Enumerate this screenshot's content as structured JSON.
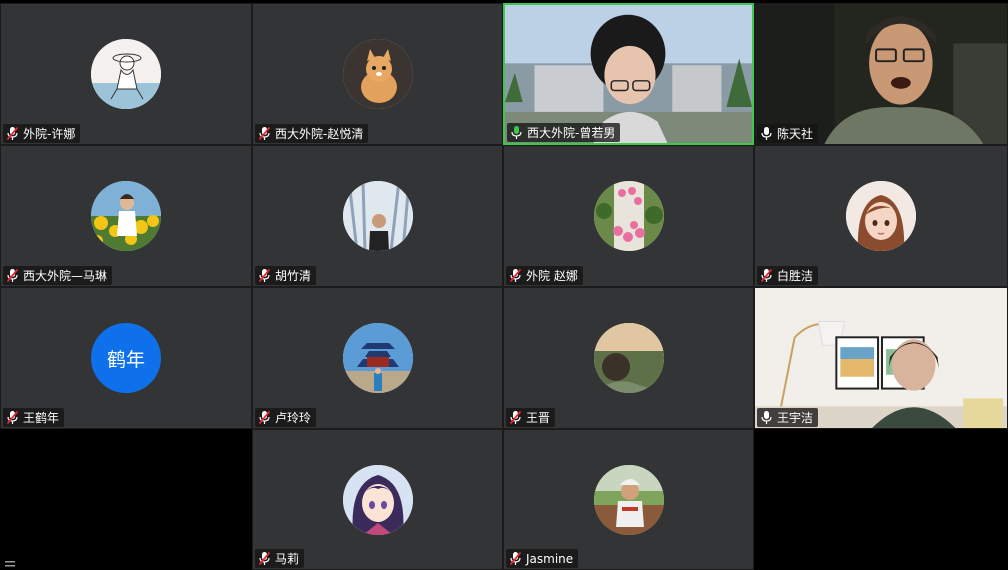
{
  "participants": [
    {
      "name": "外院-许娜",
      "mic": "muted",
      "avatar": "sketch-girl-avatar"
    },
    {
      "name": "西大外院-赵悦清",
      "mic": "muted",
      "avatar": "kitten-avatar"
    },
    {
      "name": "西大外院-曾若男",
      "mic": "active",
      "avatar": "video-feed",
      "speaking": true
    },
    {
      "name": "陈天社",
      "mic": "unmuted",
      "avatar": "video-feed"
    },
    {
      "name": "西大外院—马琳",
      "mic": "muted",
      "avatar": "sunflower-avatar"
    },
    {
      "name": "胡竹清",
      "mic": "muted",
      "avatar": "man-photo-avatar"
    },
    {
      "name": "外院 赵娜",
      "mic": "muted",
      "avatar": "flowers-avatar"
    },
    {
      "name": "白胜洁",
      "mic": "muted",
      "avatar": "cartoon-woman-avatar"
    },
    {
      "name": "王鹤年",
      "mic": "muted",
      "avatar": "initials",
      "initials": "鹤年"
    },
    {
      "name": "卢玲玲",
      "mic": "muted",
      "avatar": "temple-avatar"
    },
    {
      "name": "王晋",
      "mic": "muted",
      "avatar": "landscape-avatar"
    },
    {
      "name": "王宇洁",
      "mic": "unmuted",
      "avatar": "video-feed"
    },
    {
      "name": "马莉",
      "mic": "muted",
      "avatar": "anime-girl-avatar"
    },
    {
      "name": "Jasmine",
      "mic": "muted",
      "avatar": "child-photo-avatar"
    }
  ],
  "colors": {
    "tile_bg": "#333436",
    "muted_mic": "#e0282e",
    "active_mic": "#3ec84f",
    "initials_bg": "#0e71eb",
    "speaker_border": "#3ec84f"
  }
}
